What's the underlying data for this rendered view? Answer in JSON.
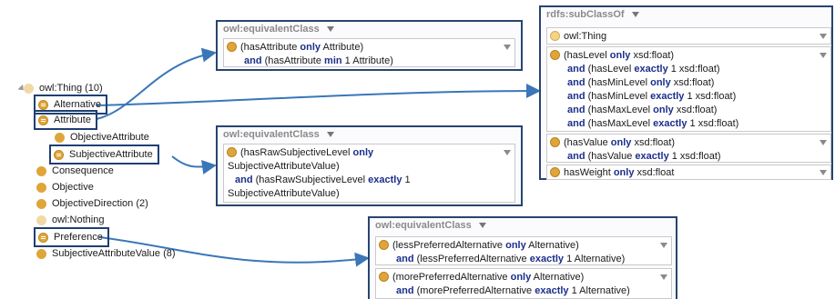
{
  "tree": {
    "root": "owl:Thing (10)",
    "items": {
      "alternative": "Alternative",
      "attribute": "Attribute",
      "objective_attribute": "ObjectiveAttribute",
      "subjective_attribute": "SubjectiveAttribute",
      "consequence": "Consequence",
      "objective": "Objective",
      "objective_direction": "ObjectiveDirection (2)",
      "nothing": "owl:Nothing",
      "preference": "Preference",
      "subjective_attribute_value": "SubjectiveAttributeValue (8)"
    }
  },
  "panels": {
    "attribute_eq": {
      "title": "owl:equivalentClass",
      "l1a": "(hasAttribute ",
      "l1b": "only",
      "l1c": " Attribute)",
      "l2a": "and",
      "l2b": " (hasAttribute ",
      "l2c": "min",
      "l2d": " 1 Attribute)"
    },
    "subjective_eq": {
      "title": "owl:equivalentClass",
      "l1a": "(hasRawSubjectiveLevel ",
      "l1b": "only",
      "l2": "SubjectiveAttributeValue)",
      "l3a": "and",
      "l3b": " (hasRawSubjectiveLevel ",
      "l3c": "exactly",
      "l3d": " 1",
      "l4": "SubjectiveAttributeValue)"
    },
    "alternative_sub": {
      "title": "rdfs:subClassOf",
      "thing": "owl:Thing",
      "r1a": "(hasLevel ",
      "r1b": "only",
      "r1c": " xsd:float)",
      "r2a": "and",
      "r2b": " (hasLevel ",
      "r2c": "exactly",
      "r2d": " 1 xsd:float)",
      "r3a": "and",
      "r3b": " (hasMinLevel ",
      "r3c": "only",
      "r3d": " xsd:float)",
      "r4a": "and",
      "r4b": " (hasMinLevel ",
      "r4c": "exactly",
      "r4d": " 1 xsd:float)",
      "r5a": "and",
      "r5b": " (hasMaxLevel ",
      "r5c": "only",
      "r5d": " xsd:float)",
      "r6a": "and",
      "r6b": " (hasMaxLevel ",
      "r6c": "exactly",
      "r6d": " 1 xsd:float)",
      "v1a": "(hasValue ",
      "v1b": "only",
      "v1c": " xsd:float)",
      "v2a": "and",
      "v2b": " (hasValue ",
      "v2c": "exactly",
      "v2d": " 1 xsd:float)",
      "w1a": "hasWeight ",
      "w1b": "only",
      "w1c": " xsd:float"
    },
    "preference_eq": {
      "title": "owl:equivalentClass",
      "p1a": "(lessPreferredAlternative ",
      "p1b": "only",
      "p1c": " Alternative)",
      "p2a": "and",
      "p2b": " (lessPreferredAlternative ",
      "p2c": "exactly",
      "p2d": " 1 Alternative)",
      "q1a": "(morePreferredAlternative ",
      "q1b": "only",
      "q1c": " Alternative)",
      "q2a": "and",
      "q2b": " (morePreferredAlternative ",
      "q2c": "exactly",
      "q2d": " 1 Alternative)"
    }
  },
  "colors": {
    "accent": "#27456f",
    "class_dot": "#e0a53a",
    "keyword": "#1b2f8a",
    "connector": "#3b76b8"
  },
  "icons": [
    "class-dot-icon",
    "equivalent-class-icon",
    "dropdown-triangle-icon"
  ]
}
